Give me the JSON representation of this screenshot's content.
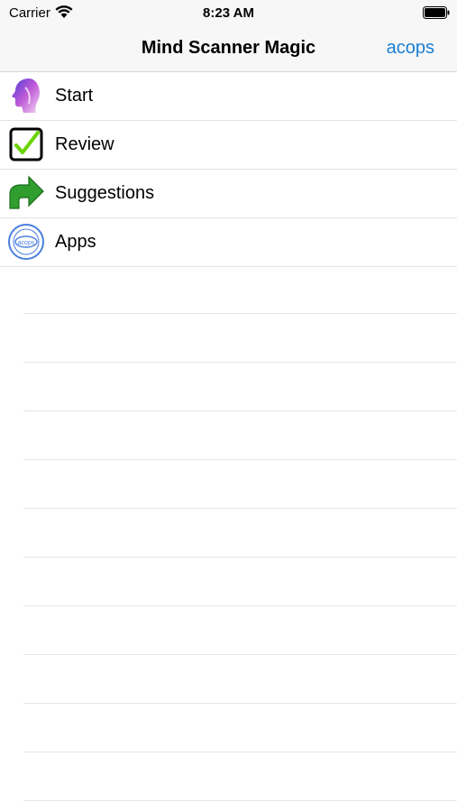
{
  "status_bar": {
    "carrier": "Carrier",
    "time": "8:23 AM"
  },
  "nav": {
    "title": "Mind Scanner Magic",
    "right_button": "acops"
  },
  "menu": [
    {
      "label": "Start",
      "icon": "head-icon"
    },
    {
      "label": "Review",
      "icon": "checkbox-icon"
    },
    {
      "label": "Suggestions",
      "icon": "arrow-icon"
    },
    {
      "label": "Apps",
      "icon": "acops-badge-icon"
    }
  ],
  "icon_badge_text": "acops",
  "colors": {
    "accent": "#1a7fd4",
    "arrow_green": "#2f9e2f",
    "check_green": "#6bd400",
    "badge_blue": "#4a7ee0"
  }
}
